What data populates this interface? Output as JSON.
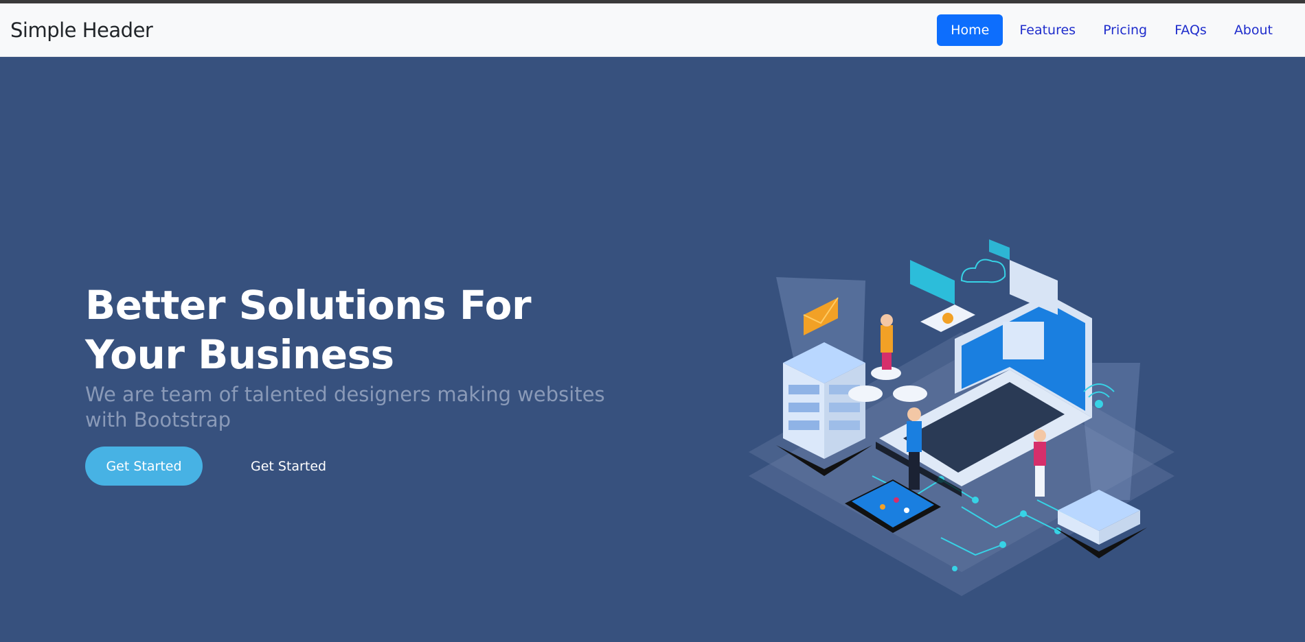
{
  "header": {
    "brand": "Simple Header",
    "nav": [
      {
        "label": "Home",
        "active": true
      },
      {
        "label": "Features"
      },
      {
        "label": "Pricing"
      },
      {
        "label": "FAQs"
      },
      {
        "label": "About"
      }
    ]
  },
  "hero": {
    "title": "Better Solutions For Your Business",
    "subtitle": "We are team of talented designers making websites with Bootstrap",
    "primary_button": "Get Started",
    "secondary_button": "Get Started"
  },
  "colors": {
    "hero_bg": "#37517e",
    "accent": "#47b2e4",
    "nav_active": "#0d6efd"
  }
}
